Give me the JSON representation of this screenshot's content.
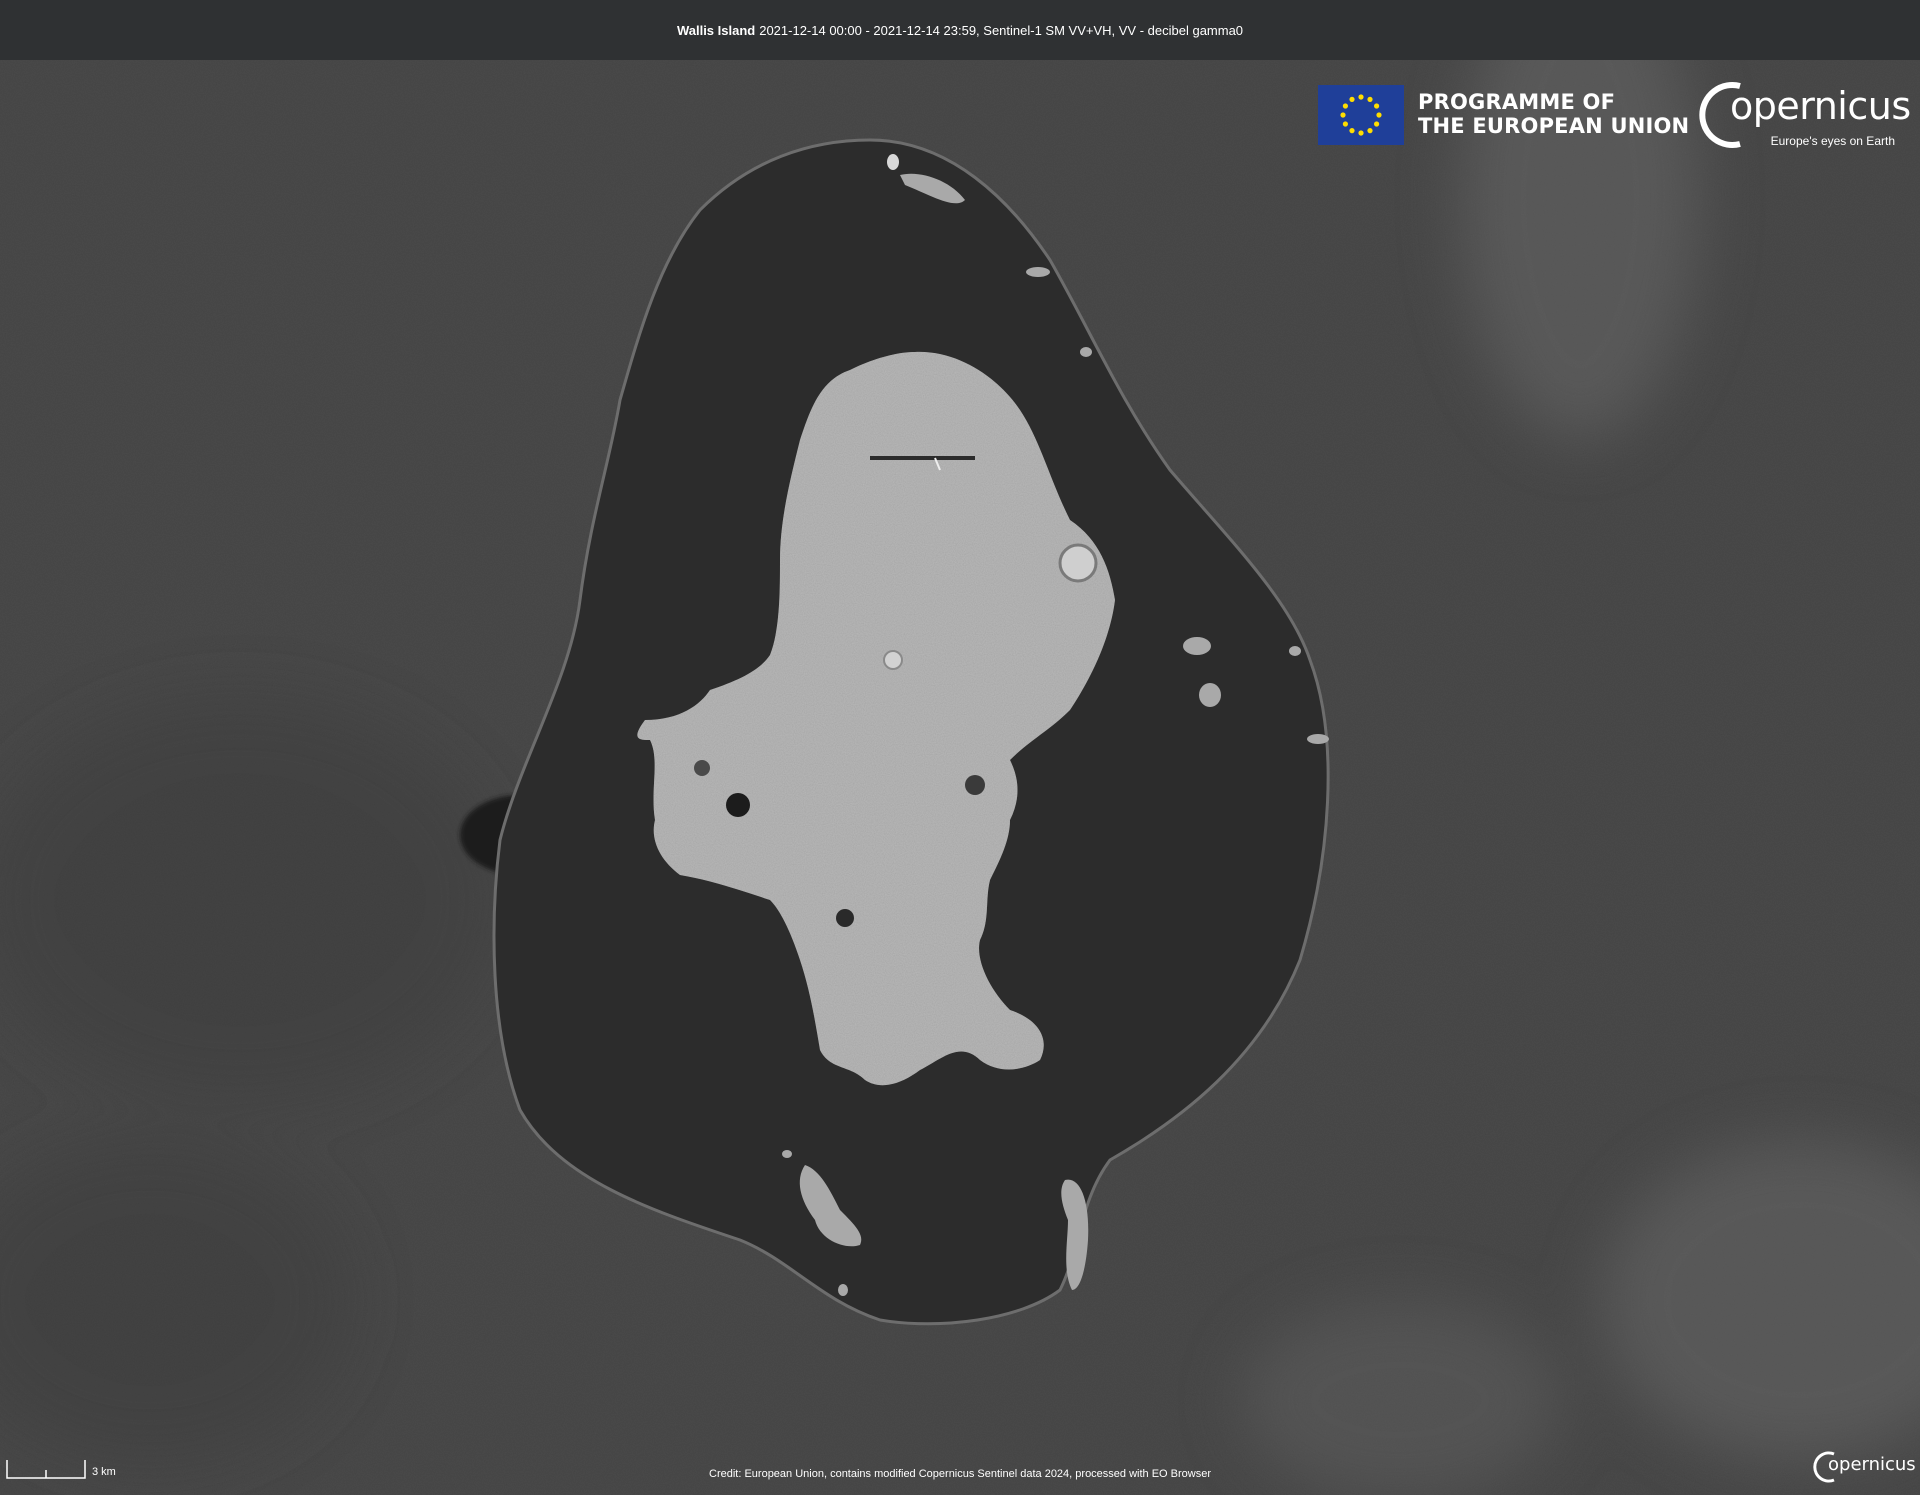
{
  "header": {
    "place": "Wallis Island",
    "details": "2021-12-14 00:00 - 2021-12-14 23:59, Sentinel-1 SM VV+VH, VV - decibel gamma0"
  },
  "logos": {
    "eu_line1": "PROGRAMME OF",
    "eu_line2": "THE EUROPEAN UNION",
    "copernicus": "opernicus",
    "copernicus_tagline": "Europe's eyes on Earth"
  },
  "scale": {
    "label": "3 km"
  },
  "footer": {
    "credit": "Credit: European Union, contains modified Copernicus Sentinel data 2024, processed with EO Browser"
  },
  "colors": {
    "ocean": "#4b4b4b",
    "lagoon": "#2c2c2c",
    "land": "#b9b9b9",
    "title_bar": "#2f3133",
    "eu_blue": "#1f3f99",
    "eu_star": "#ffdd00"
  },
  "icons": {
    "eu_flag": "eu-flag-icon",
    "copernicus": "copernicus-logo-icon"
  }
}
